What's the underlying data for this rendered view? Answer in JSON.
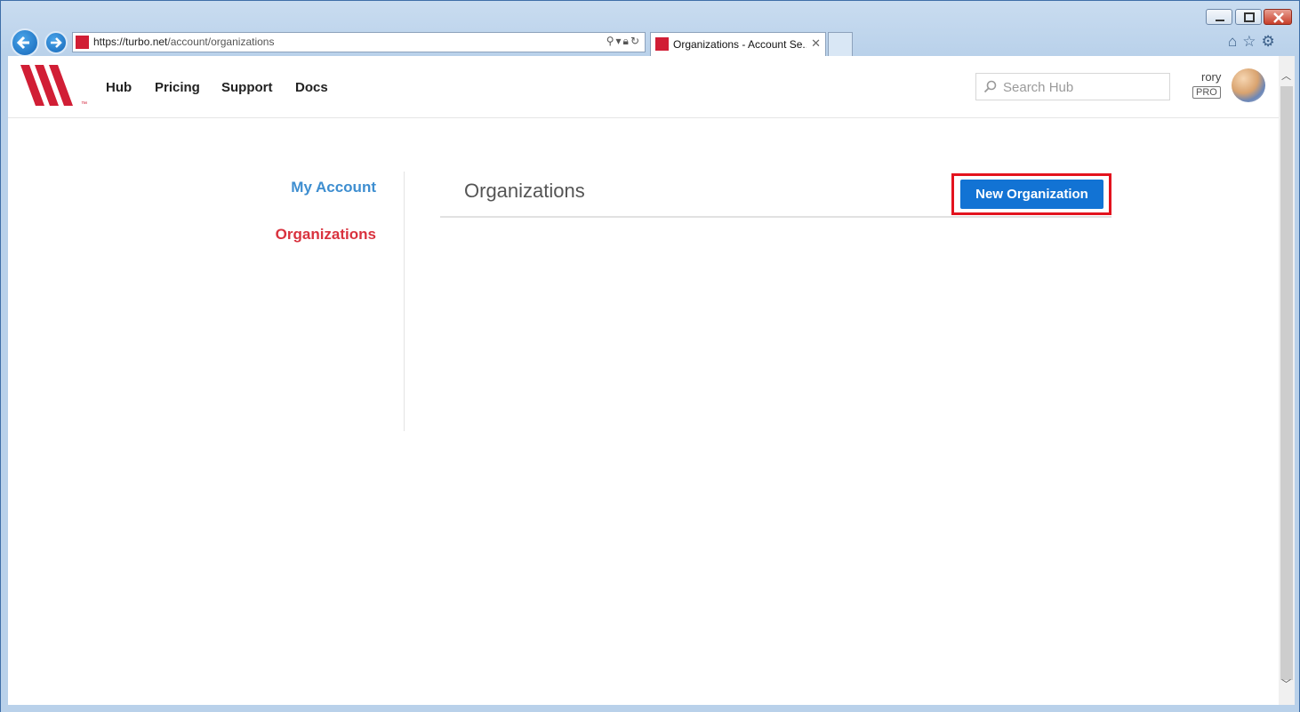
{
  "browser": {
    "address": {
      "scheme_host": "https://turbo.net",
      "path": "/account/organizations"
    },
    "tab_title": "Organizations - Account Se...",
    "tab_close": "✕"
  },
  "header": {
    "nav": [
      "Hub",
      "Pricing",
      "Support",
      "Docs"
    ],
    "search_placeholder": "Search Hub",
    "username": "rory",
    "badge": "PRO",
    "logo_tm": "™"
  },
  "sidebar": {
    "items": [
      {
        "label": "My Account",
        "color": "#3e8ed0"
      },
      {
        "label": "Organizations",
        "color": "#d9323e"
      }
    ]
  },
  "main": {
    "title": "Organizations",
    "new_button_label": "New Organization",
    "button_color": "#1273d4",
    "highlight_color": "#e3131e"
  }
}
